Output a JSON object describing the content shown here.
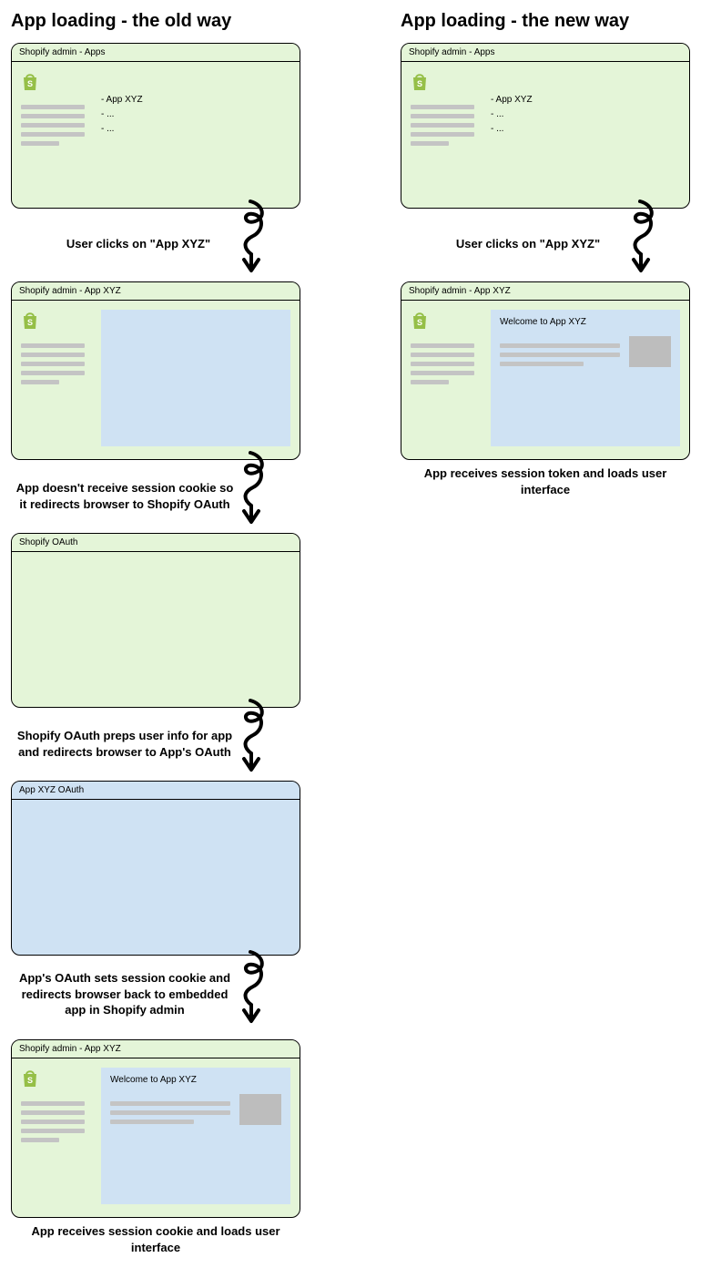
{
  "old": {
    "heading": "App loading - the old way",
    "panels": [
      {
        "title": "Shopify admin - Apps"
      },
      {
        "title": "Shopify admin - App XYZ"
      },
      {
        "title": "Shopify OAuth"
      },
      {
        "title": "App XYZ OAuth"
      },
      {
        "title": "Shopify admin - App XYZ"
      }
    ],
    "list_items": [
      "- App XYZ",
      "- ...",
      "- ..."
    ],
    "iframe_welcome": "Welcome to App XYZ",
    "captions": [
      "User clicks on \"App XYZ\"",
      "App doesn't receive session cookie so it redirects browser to Shopify OAuth",
      "Shopify OAuth preps user info for app and redirects browser to App's OAuth",
      "App's OAuth sets session cookie and redirects browser back to embedded app in Shopify admin"
    ],
    "final": "App receives session cookie and loads user interface"
  },
  "new": {
    "heading": "App loading - the new way",
    "panels": [
      {
        "title": "Shopify admin - Apps"
      },
      {
        "title": "Shopify admin - App XYZ"
      }
    ],
    "list_items": [
      "- App XYZ",
      "- ...",
      "- ..."
    ],
    "iframe_welcome": "Welcome to App XYZ",
    "captions": [
      "User clicks on \"App XYZ\""
    ],
    "final": "App receives session token and loads user interface"
  },
  "colors": {
    "green": "#e4f5d8",
    "blue": "#cfe2f3",
    "bar": "#c4c4c4",
    "shopify": "#95bf47"
  }
}
